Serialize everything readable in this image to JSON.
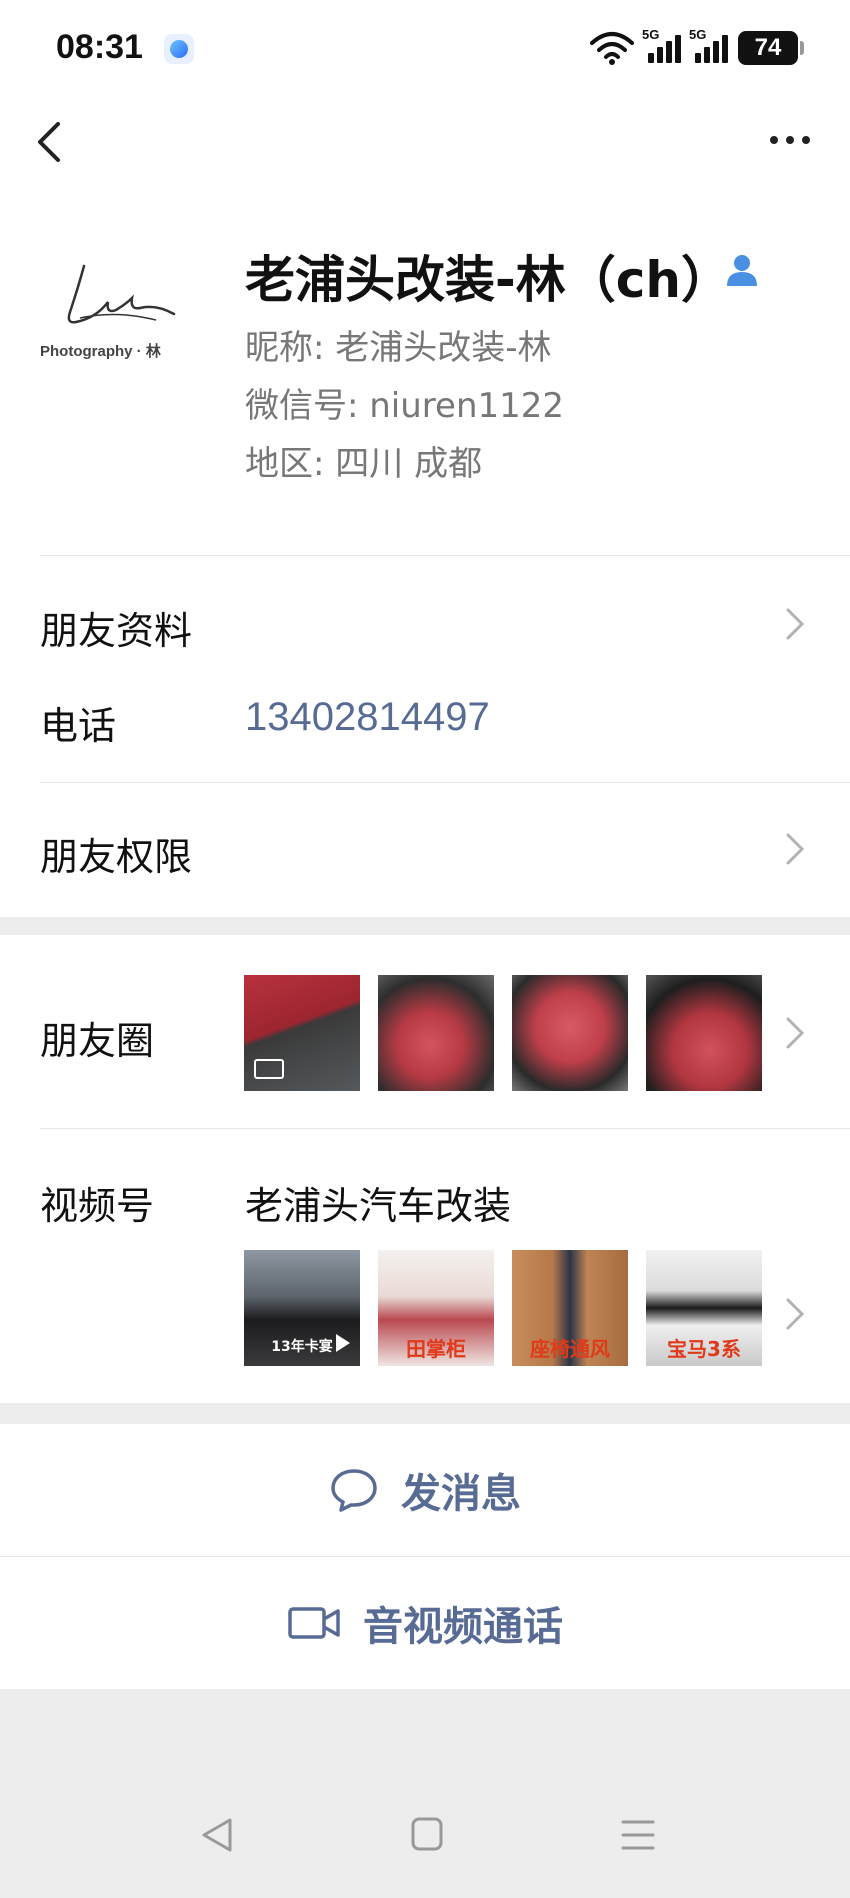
{
  "status_bar": {
    "time": "08:31",
    "network_1": "5G",
    "network_2": "5G",
    "battery": "74"
  },
  "profile": {
    "avatar_text": "Photography · 林",
    "name": "老浦头改装-林（ch）",
    "nickname": "昵称: 老浦头改装-林",
    "wechat_id": "微信号: niuren1122",
    "region": "地区: 四川  成都"
  },
  "rows": {
    "friend_info": "朋友资料",
    "phone_label": "电话",
    "phone_value": "13402814497",
    "permissions": "朋友权限",
    "moments": "朋友圈",
    "channels": "视频号",
    "channel_name": "老浦头汽车改装"
  },
  "channel_thumbs": {
    "t1": "13年卡宴",
    "t2": "田掌柜",
    "t3": "座椅通风",
    "t4": "宝马3系"
  },
  "actions": {
    "message": "发消息",
    "call": "音视频通话"
  },
  "colors": {
    "link": "#576b95",
    "background": "#ededed",
    "card": "#ffffff"
  }
}
